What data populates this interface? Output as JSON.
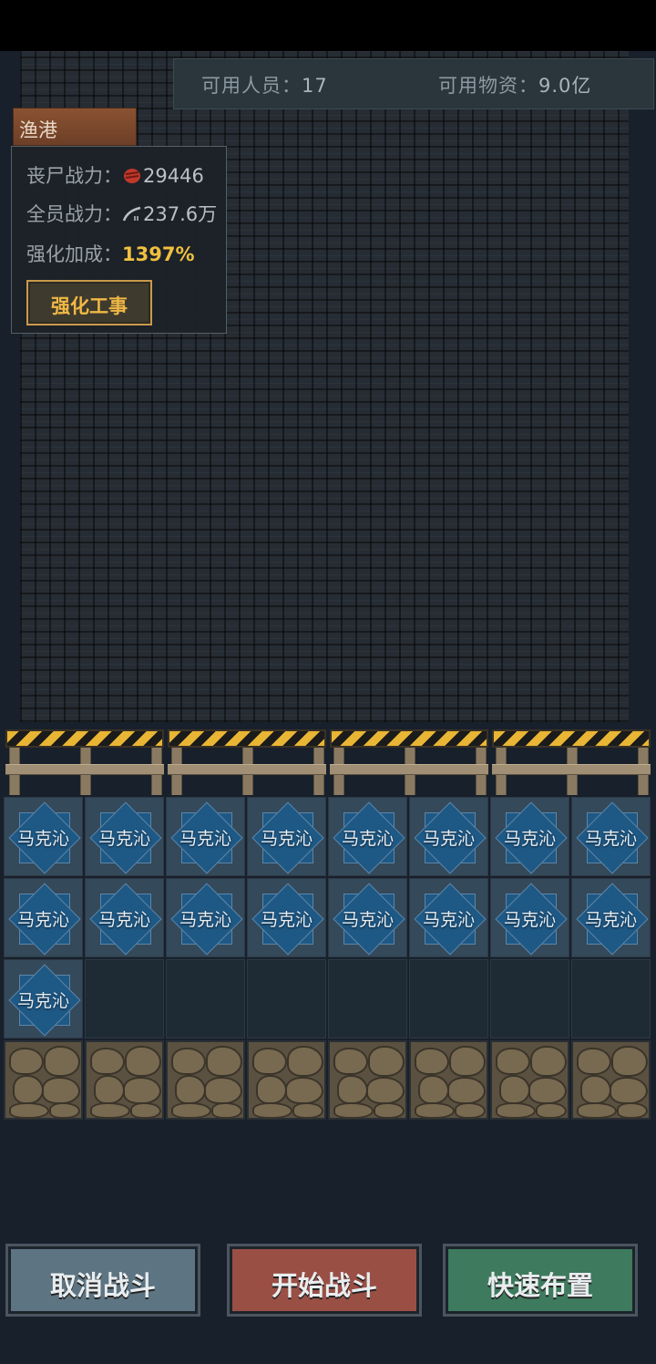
{
  "resources": {
    "people_label": "可用人员：",
    "people_value": "17",
    "supplies_label": "可用物资：",
    "supplies_value": "9.0亿"
  },
  "location": {
    "name": "渔港"
  },
  "stats": {
    "zombie_power_label": "丧尸战力：",
    "zombie_power_value": "29446",
    "team_power_label": "全员战力：",
    "team_power_value": "237.6万",
    "bonus_label": "强化加成：",
    "bonus_value": "1397%"
  },
  "fortify_button": "强化工事",
  "units": [
    {
      "name": "马克沁"
    },
    {
      "name": "马克沁"
    },
    {
      "name": "马克沁"
    },
    {
      "name": "马克沁"
    },
    {
      "name": "马克沁"
    },
    {
      "name": "马克沁"
    },
    {
      "name": "马克沁"
    },
    {
      "name": "马克沁"
    },
    {
      "name": "马克沁"
    },
    {
      "name": "马克沁"
    },
    {
      "name": "马克沁"
    },
    {
      "name": "马克沁"
    },
    {
      "name": "马克沁"
    },
    {
      "name": "马克沁"
    },
    {
      "name": "马克沁"
    },
    {
      "name": "马克沁"
    },
    {
      "name": "马克沁"
    }
  ],
  "grid": {
    "columns": 8,
    "unit_rows": 3,
    "rock_rows": 1
  },
  "buttons": {
    "cancel": "取消战斗",
    "start": "开始战斗",
    "quick": "快速布置"
  },
  "colors": {
    "cancel_button": "#5d7482",
    "start_button": "#9a4f45",
    "quick_button": "#3d7a5e",
    "bonus_text": "#f0c040",
    "fortify_text": "#f0b845"
  },
  "icons": {
    "zombie_power": "zombie-head-icon",
    "team_power": "rifle-icon"
  }
}
